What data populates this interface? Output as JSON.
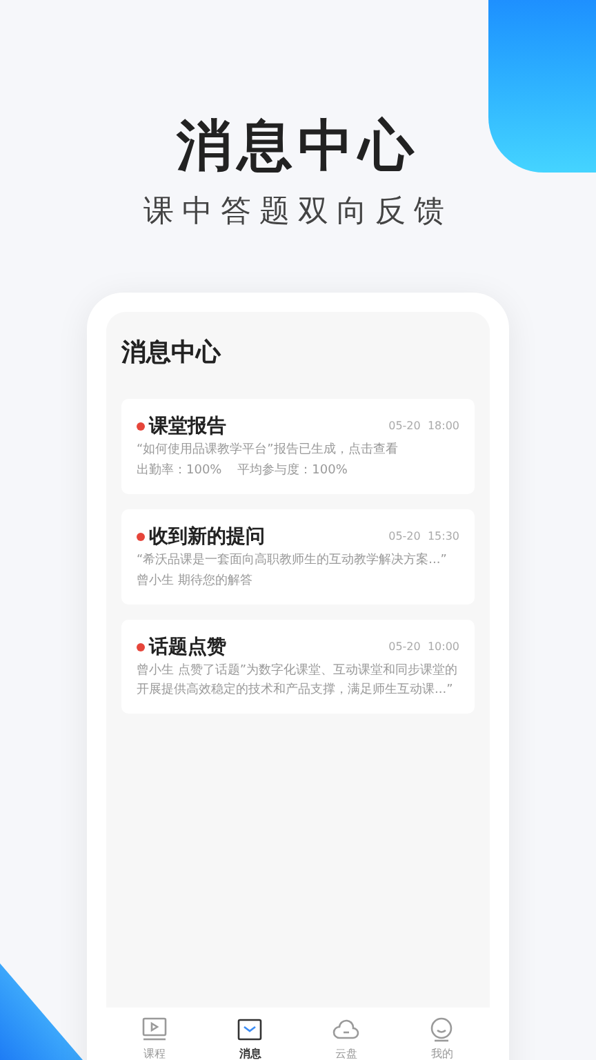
{
  "headline": "消息中心",
  "subtitle": "课中答题双向反馈",
  "screen": {
    "title": "消息中心",
    "messages": [
      {
        "title": "课堂报告",
        "unread": true,
        "time": "05-20  18:00",
        "lines": [
          "“如何使用品课教学平台”报告已生成，点击查看",
          "出勤率：100%    平均参与度：100%"
        ]
      },
      {
        "title": "收到新的提问",
        "unread": true,
        "time": "05-20  15:30",
        "lines": [
          "“希沃品课是一套面向高职教师生的互动教学解决方案...”",
          "曾小生 期待您的解答"
        ]
      },
      {
        "title": "话题点赞",
        "unread": true,
        "time": "05-20  10:00",
        "lines": [
          "曾小生 点赞了话题”为数字化课堂、互动课堂和同步课堂的开展提供高效稳定的技术和产品支撑，满足师生互动课...”"
        ]
      }
    ]
  },
  "tab_bar": [
    {
      "label": "课程",
      "kind": "course",
      "selected": false
    },
    {
      "label": "消息",
      "kind": "message",
      "selected": true
    },
    {
      "label": "云盘",
      "kind": "cloud",
      "selected": false
    },
    {
      "label": "我的",
      "kind": "profile",
      "selected": false
    }
  ]
}
